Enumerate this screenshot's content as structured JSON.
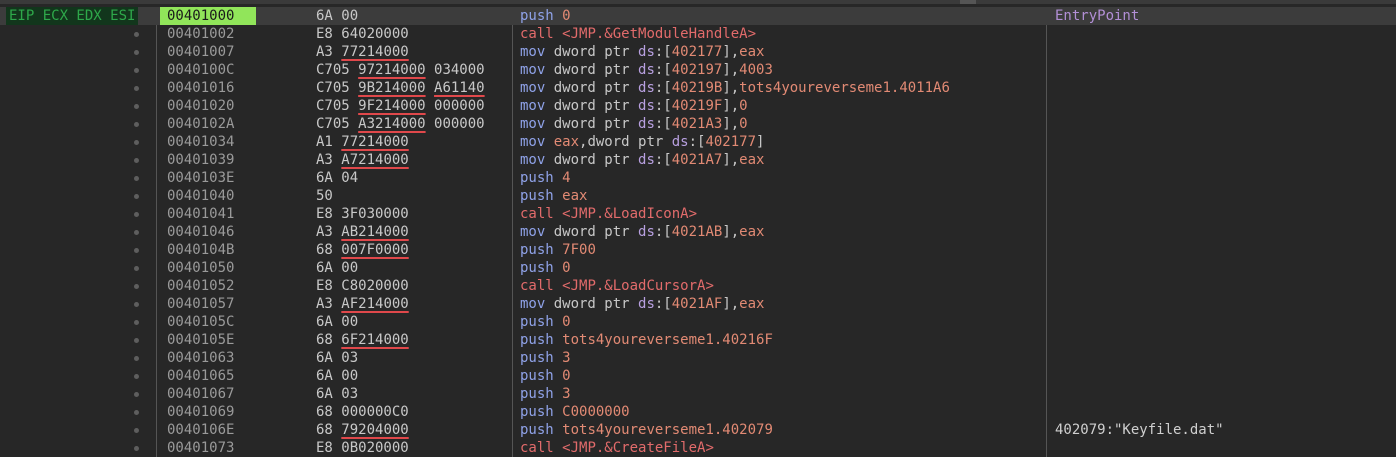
{
  "registers": "EIP ECX EDX ESI",
  "comment_header": "EntryPoint",
  "rows": [
    {
      "addr": "00401000",
      "bytes": [
        {
          "t": "6A 00"
        }
      ],
      "dis": [
        {
          "c": "m-push",
          "t": "push "
        },
        {
          "c": "lit",
          "t": "0"
        }
      ],
      "cmt": "EntryPoint"
    },
    {
      "addr": "00401002",
      "bytes": [
        {
          "t": "E8 64020000"
        }
      ],
      "dis": [
        {
          "c": "m-call",
          "t": "call "
        },
        {
          "c": "m-call",
          "t": "<JMP.&GetModuleHandleA>"
        }
      ],
      "cmt": ""
    },
    {
      "addr": "00401007",
      "bytes": [
        {
          "t": "A3 "
        },
        {
          "t": "77214000",
          "u": 1
        }
      ],
      "dis": [
        {
          "c": "m-mov",
          "t": "mov "
        },
        {
          "c": "gray",
          "t": "dword ptr "
        },
        {
          "c": "seg",
          "t": "ds"
        },
        {
          "c": "gray",
          "t": ":["
        },
        {
          "c": "lit",
          "t": "402177"
        },
        {
          "c": "gray",
          "t": "],"
        },
        {
          "c": "lit",
          "t": "eax"
        }
      ],
      "cmt": ""
    },
    {
      "addr": "0040100C",
      "bytes": [
        {
          "t": "C705 "
        },
        {
          "t": "97214000",
          "u": 1
        },
        {
          "t": " 034000"
        }
      ],
      "dis": [
        {
          "c": "m-mov",
          "t": "mov "
        },
        {
          "c": "gray",
          "t": "dword ptr "
        },
        {
          "c": "seg",
          "t": "ds"
        },
        {
          "c": "gray",
          "t": ":["
        },
        {
          "c": "lit",
          "t": "402197"
        },
        {
          "c": "gray",
          "t": "],"
        },
        {
          "c": "lit",
          "t": "4003"
        }
      ],
      "cmt": ""
    },
    {
      "addr": "00401016",
      "bytes": [
        {
          "t": "C705 "
        },
        {
          "t": "9B214000",
          "u": 1
        },
        {
          "t": " "
        },
        {
          "t": "A61140",
          "u": 1
        }
      ],
      "dis": [
        {
          "c": "m-mov",
          "t": "mov "
        },
        {
          "c": "gray",
          "t": "dword ptr "
        },
        {
          "c": "seg",
          "t": "ds"
        },
        {
          "c": "gray",
          "t": ":["
        },
        {
          "c": "lit",
          "t": "40219B"
        },
        {
          "c": "gray",
          "t": "],"
        },
        {
          "c": "lit",
          "t": "tots4youreverseme1.4011A6"
        }
      ],
      "cmt": ""
    },
    {
      "addr": "00401020",
      "bytes": [
        {
          "t": "C705 "
        },
        {
          "t": "9F214000",
          "u": 1
        },
        {
          "t": " 000000"
        }
      ],
      "dis": [
        {
          "c": "m-mov",
          "t": "mov "
        },
        {
          "c": "gray",
          "t": "dword ptr "
        },
        {
          "c": "seg",
          "t": "ds"
        },
        {
          "c": "gray",
          "t": ":["
        },
        {
          "c": "lit",
          "t": "40219F"
        },
        {
          "c": "gray",
          "t": "],"
        },
        {
          "c": "lit",
          "t": "0"
        }
      ],
      "cmt": ""
    },
    {
      "addr": "0040102A",
      "bytes": [
        {
          "t": "C705 "
        },
        {
          "t": "A3214000",
          "u": 1
        },
        {
          "t": " 000000"
        }
      ],
      "dis": [
        {
          "c": "m-mov",
          "t": "mov "
        },
        {
          "c": "gray",
          "t": "dword ptr "
        },
        {
          "c": "seg",
          "t": "ds"
        },
        {
          "c": "gray",
          "t": ":["
        },
        {
          "c": "lit",
          "t": "4021A3"
        },
        {
          "c": "gray",
          "t": "],"
        },
        {
          "c": "lit",
          "t": "0"
        }
      ],
      "cmt": ""
    },
    {
      "addr": "00401034",
      "bytes": [
        {
          "t": "A1 "
        },
        {
          "t": "77214000",
          "u": 1
        }
      ],
      "dis": [
        {
          "c": "m-mov",
          "t": "mov "
        },
        {
          "c": "lit",
          "t": "eax"
        },
        {
          "c": "gray",
          "t": ",dword ptr "
        },
        {
          "c": "seg",
          "t": "ds"
        },
        {
          "c": "gray",
          "t": ":["
        },
        {
          "c": "lit",
          "t": "402177"
        },
        {
          "c": "gray",
          "t": "]"
        }
      ],
      "cmt": ""
    },
    {
      "addr": "00401039",
      "bytes": [
        {
          "t": "A3 "
        },
        {
          "t": "A7214000",
          "u": 1
        }
      ],
      "dis": [
        {
          "c": "m-mov",
          "t": "mov "
        },
        {
          "c": "gray",
          "t": "dword ptr "
        },
        {
          "c": "seg",
          "t": "ds"
        },
        {
          "c": "gray",
          "t": ":["
        },
        {
          "c": "lit",
          "t": "4021A7"
        },
        {
          "c": "gray",
          "t": "],"
        },
        {
          "c": "lit",
          "t": "eax"
        }
      ],
      "cmt": ""
    },
    {
      "addr": "0040103E",
      "bytes": [
        {
          "t": "6A 04"
        }
      ],
      "dis": [
        {
          "c": "m-push",
          "t": "push "
        },
        {
          "c": "lit",
          "t": "4"
        }
      ],
      "cmt": ""
    },
    {
      "addr": "00401040",
      "bytes": [
        {
          "t": "50"
        }
      ],
      "dis": [
        {
          "c": "m-push",
          "t": "push "
        },
        {
          "c": "lit",
          "t": "eax"
        }
      ],
      "cmt": ""
    },
    {
      "addr": "00401041",
      "bytes": [
        {
          "t": "E8 3F030000"
        }
      ],
      "dis": [
        {
          "c": "m-call",
          "t": "call "
        },
        {
          "c": "m-call",
          "t": "<JMP.&LoadIconA>"
        }
      ],
      "cmt": ""
    },
    {
      "addr": "00401046",
      "bytes": [
        {
          "t": "A3 "
        },
        {
          "t": "AB214000",
          "u": 1
        }
      ],
      "dis": [
        {
          "c": "m-mov",
          "t": "mov "
        },
        {
          "c": "gray",
          "t": "dword ptr "
        },
        {
          "c": "seg",
          "t": "ds"
        },
        {
          "c": "gray",
          "t": ":["
        },
        {
          "c": "lit",
          "t": "4021AB"
        },
        {
          "c": "gray",
          "t": "],"
        },
        {
          "c": "lit",
          "t": "eax"
        }
      ],
      "cmt": ""
    },
    {
      "addr": "0040104B",
      "bytes": [
        {
          "t": "68 "
        },
        {
          "t": "007F0000",
          "u": 1
        }
      ],
      "dis": [
        {
          "c": "m-push",
          "t": "push "
        },
        {
          "c": "lit",
          "t": "7F00"
        }
      ],
      "cmt": ""
    },
    {
      "addr": "00401050",
      "bytes": [
        {
          "t": "6A 00"
        }
      ],
      "dis": [
        {
          "c": "m-push",
          "t": "push "
        },
        {
          "c": "lit",
          "t": "0"
        }
      ],
      "cmt": ""
    },
    {
      "addr": "00401052",
      "bytes": [
        {
          "t": "E8 C8020000"
        }
      ],
      "dis": [
        {
          "c": "m-call",
          "t": "call "
        },
        {
          "c": "m-call",
          "t": "<JMP.&LoadCursorA>"
        }
      ],
      "cmt": ""
    },
    {
      "addr": "00401057",
      "bytes": [
        {
          "t": "A3 "
        },
        {
          "t": "AF214000",
          "u": 1
        }
      ],
      "dis": [
        {
          "c": "m-mov",
          "t": "mov "
        },
        {
          "c": "gray",
          "t": "dword ptr "
        },
        {
          "c": "seg",
          "t": "ds"
        },
        {
          "c": "gray",
          "t": ":["
        },
        {
          "c": "lit",
          "t": "4021AF"
        },
        {
          "c": "gray",
          "t": "],"
        },
        {
          "c": "lit",
          "t": "eax"
        }
      ],
      "cmt": ""
    },
    {
      "addr": "0040105C",
      "bytes": [
        {
          "t": "6A 00"
        }
      ],
      "dis": [
        {
          "c": "m-push",
          "t": "push "
        },
        {
          "c": "lit",
          "t": "0"
        }
      ],
      "cmt": ""
    },
    {
      "addr": "0040105E",
      "bytes": [
        {
          "t": "68 "
        },
        {
          "t": "6F214000",
          "u": 1
        }
      ],
      "dis": [
        {
          "c": "m-push",
          "t": "push "
        },
        {
          "c": "lit",
          "t": "tots4youreverseme1.40216F"
        }
      ],
      "cmt": ""
    },
    {
      "addr": "00401063",
      "bytes": [
        {
          "t": "6A 03"
        }
      ],
      "dis": [
        {
          "c": "m-push",
          "t": "push "
        },
        {
          "c": "lit",
          "t": "3"
        }
      ],
      "cmt": ""
    },
    {
      "addr": "00401065",
      "bytes": [
        {
          "t": "6A 00"
        }
      ],
      "dis": [
        {
          "c": "m-push",
          "t": "push "
        },
        {
          "c": "lit",
          "t": "0"
        }
      ],
      "cmt": ""
    },
    {
      "addr": "00401067",
      "bytes": [
        {
          "t": "6A 03"
        }
      ],
      "dis": [
        {
          "c": "m-push",
          "t": "push "
        },
        {
          "c": "lit",
          "t": "3"
        }
      ],
      "cmt": ""
    },
    {
      "addr": "00401069",
      "bytes": [
        {
          "t": "68 000000C0"
        }
      ],
      "dis": [
        {
          "c": "m-push",
          "t": "push "
        },
        {
          "c": "lit",
          "t": "C0000000"
        }
      ],
      "cmt": ""
    },
    {
      "addr": "0040106E",
      "bytes": [
        {
          "t": "68 "
        },
        {
          "t": "79204000",
          "u": 1
        }
      ],
      "dis": [
        {
          "c": "m-push",
          "t": "push "
        },
        {
          "c": "lit",
          "t": "tots4youreverseme1.402079"
        }
      ],
      "cmt": "402079:\"Keyfile.dat\""
    },
    {
      "addr": "00401073",
      "bytes": [
        {
          "t": "E8 0B020000"
        }
      ],
      "dis": [
        {
          "c": "m-call",
          "t": "call "
        },
        {
          "c": "m-call",
          "t": "<JMP.&CreateFileA>"
        }
      ],
      "cmt": ""
    }
  ],
  "colors": {
    "current_addr_bg": "#91e55a",
    "reg_label": "#2ea84a",
    "underline": "#e0484b"
  }
}
